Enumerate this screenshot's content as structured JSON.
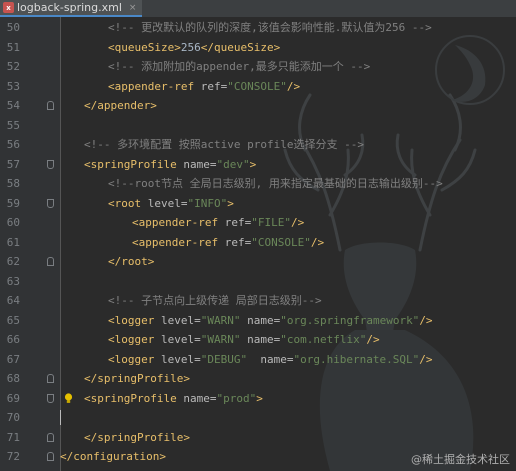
{
  "tab": {
    "filename": "logback-spring.xml",
    "icon": "xml-file-icon",
    "close_glyph": "×"
  },
  "colors": {
    "background": "#2b2b2b",
    "gutter": "#313335",
    "tag": "#e8bf6a",
    "attribute": "#bababa",
    "value": "#6a8759",
    "text": "#a9b7c6",
    "comment": "#808080"
  },
  "lines": [
    {
      "num": "50",
      "indent": 4,
      "fold": "",
      "segments": [
        {
          "t": "c",
          "s": "<!-- 更改默认的队列的深度,该值会影响性能.默认值为256 -->"
        }
      ]
    },
    {
      "num": "51",
      "indent": 4,
      "fold": "",
      "segments": [
        {
          "t": "g",
          "s": "<queueSize>"
        },
        {
          "t": "x",
          "s": "256"
        },
        {
          "t": "g",
          "s": "</queueSize>"
        }
      ]
    },
    {
      "num": "52",
      "indent": 4,
      "fold": "",
      "segments": [
        {
          "t": "c",
          "s": "<!-- 添加附加的appender,最多只能添加一个 -->"
        }
      ]
    },
    {
      "num": "53",
      "indent": 4,
      "fold": "",
      "segments": [
        {
          "t": "g",
          "s": "<appender-ref "
        },
        {
          "t": "a",
          "s": "ref="
        },
        {
          "t": "v",
          "s": "\"CONSOLE\""
        },
        {
          "t": "g",
          "s": "/>"
        }
      ]
    },
    {
      "num": "54",
      "indent": 2,
      "fold": "close",
      "segments": [
        {
          "t": "g",
          "s": "</appender>"
        }
      ]
    },
    {
      "num": "55",
      "indent": 0,
      "fold": "",
      "segments": []
    },
    {
      "num": "56",
      "indent": 2,
      "fold": "",
      "segments": [
        {
          "t": "c",
          "s": "<!-- 多环境配置 按照active profile选择分支 -->"
        }
      ]
    },
    {
      "num": "57",
      "indent": 2,
      "fold": "open",
      "segments": [
        {
          "t": "g",
          "s": "<springProfile "
        },
        {
          "t": "a",
          "s": "name="
        },
        {
          "t": "v",
          "s": "\"dev\""
        },
        {
          "t": "g",
          "s": ">"
        }
      ]
    },
    {
      "num": "58",
      "indent": 4,
      "fold": "",
      "segments": [
        {
          "t": "c",
          "s": "<!--root节点 全局日志级别, 用来指定最基础的日志输出级别-->"
        }
      ]
    },
    {
      "num": "59",
      "indent": 4,
      "fold": "open",
      "segments": [
        {
          "t": "g",
          "s": "<root "
        },
        {
          "t": "a",
          "s": "level="
        },
        {
          "t": "v",
          "s": "\"INFO\""
        },
        {
          "t": "g",
          "s": ">"
        }
      ]
    },
    {
      "num": "60",
      "indent": 6,
      "fold": "",
      "segments": [
        {
          "t": "g",
          "s": "<appender-ref "
        },
        {
          "t": "a",
          "s": "ref="
        },
        {
          "t": "v",
          "s": "\"FILE\""
        },
        {
          "t": "g",
          "s": "/>"
        }
      ]
    },
    {
      "num": "61",
      "indent": 6,
      "fold": "",
      "segments": [
        {
          "t": "g",
          "s": "<appender-ref "
        },
        {
          "t": "a",
          "s": "ref="
        },
        {
          "t": "v",
          "s": "\"CONSOLE\""
        },
        {
          "t": "g",
          "s": "/>"
        }
      ]
    },
    {
      "num": "62",
      "indent": 4,
      "fold": "close",
      "segments": [
        {
          "t": "g",
          "s": "</root>"
        }
      ]
    },
    {
      "num": "63",
      "indent": 0,
      "fold": "",
      "segments": []
    },
    {
      "num": "64",
      "indent": 4,
      "fold": "",
      "segments": [
        {
          "t": "c",
          "s": "<!-- 子节点向上级传递 局部日志级别-->"
        }
      ]
    },
    {
      "num": "65",
      "indent": 4,
      "fold": "",
      "segments": [
        {
          "t": "g",
          "s": "<logger "
        },
        {
          "t": "a",
          "s": "level="
        },
        {
          "t": "v",
          "s": "\"WARN\""
        },
        {
          "t": "a",
          "s": " name="
        },
        {
          "t": "v",
          "s": "\"org.springframework\""
        },
        {
          "t": "g",
          "s": "/>"
        }
      ]
    },
    {
      "num": "66",
      "indent": 4,
      "fold": "",
      "segments": [
        {
          "t": "g",
          "s": "<logger "
        },
        {
          "t": "a",
          "s": "level="
        },
        {
          "t": "v",
          "s": "\"WARN\""
        },
        {
          "t": "a",
          "s": " name="
        },
        {
          "t": "v",
          "s": "\"com.netflix\""
        },
        {
          "t": "g",
          "s": "/>"
        }
      ]
    },
    {
      "num": "67",
      "indent": 4,
      "fold": "",
      "segments": [
        {
          "t": "g",
          "s": "<logger "
        },
        {
          "t": "a",
          "s": "level="
        },
        {
          "t": "v",
          "s": "\"DEBUG\""
        },
        {
          "t": "a",
          "s": "  name="
        },
        {
          "t": "v",
          "s": "\"org.hibernate.SQL\""
        },
        {
          "t": "g",
          "s": "/>"
        }
      ]
    },
    {
      "num": "68",
      "indent": 2,
      "fold": "close",
      "segments": [
        {
          "t": "g",
          "s": "</springProfile>"
        }
      ]
    },
    {
      "num": "69",
      "indent": 2,
      "fold": "open",
      "bulb": true,
      "segments": [
        {
          "t": "g",
          "s": "<springProfile "
        },
        {
          "t": "a",
          "s": "name="
        },
        {
          "t": "v",
          "s": "\"prod\""
        },
        {
          "t": "g",
          "s": ">"
        }
      ]
    },
    {
      "num": "70",
      "indent": 0,
      "fold": "",
      "caret": true,
      "segments": []
    },
    {
      "num": "71",
      "indent": 2,
      "fold": "close",
      "segments": [
        {
          "t": "g",
          "s": "</springProfile>"
        }
      ]
    },
    {
      "num": "72",
      "indent": 0,
      "fold": "close",
      "segments": [
        {
          "t": "g",
          "s": "</configuration>"
        }
      ]
    }
  ],
  "watermark": "@稀土掘金技术社区"
}
